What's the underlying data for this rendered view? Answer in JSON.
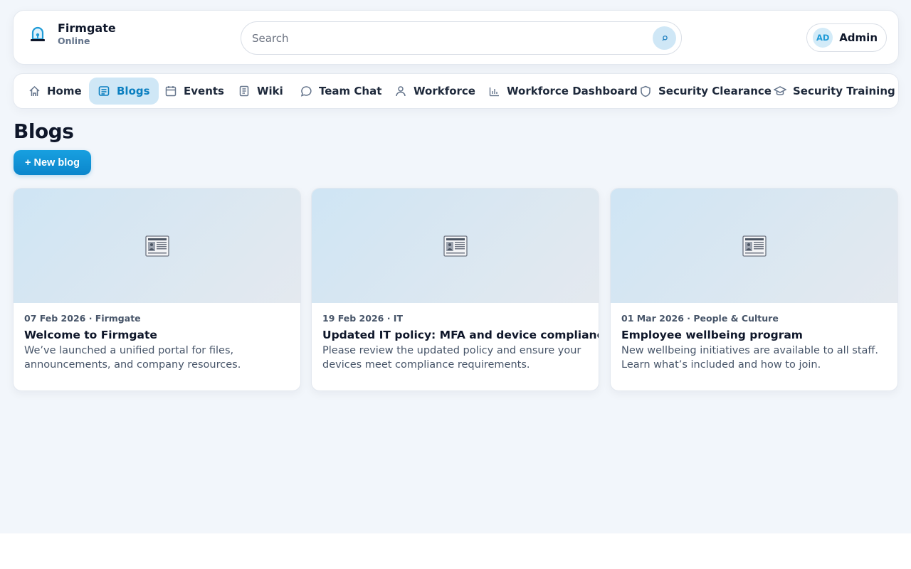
{
  "header": {
    "brand_name": "Firmgate",
    "brand_status": "Online",
    "search_placeholder": "Search",
    "user_initials": "AD",
    "user_name": "Admin"
  },
  "nav": {
    "items": [
      {
        "label": "Home",
        "icon": "home-icon"
      },
      {
        "label": "Blogs",
        "icon": "blog-icon",
        "active": true
      },
      {
        "label": "Events",
        "icon": "calendar-icon"
      },
      {
        "label": "Wiki",
        "icon": "book-icon"
      },
      {
        "label": "Team Chat",
        "icon": "chat-icon"
      },
      {
        "label": "Workforce",
        "icon": "user-icon"
      },
      {
        "label": "Workforce Dashboard",
        "icon": "bar-chart-icon"
      },
      {
        "label": "Security Clearance",
        "icon": "shield-icon"
      },
      {
        "label": "Security Training",
        "icon": "graduation-cap-icon"
      }
    ]
  },
  "main": {
    "title": "Blogs",
    "new_button_label": "+ New blog",
    "posts": [
      {
        "meta": "07 Feb 2026 · Firmgate",
        "title": "Welcome to Firmgate",
        "excerpt": "We’ve launched a unified portal for files, announcements, and company resources.",
        "image_icon": "newspaper-icon"
      },
      {
        "meta": "19 Feb 2026 · IT",
        "title": "Updated IT policy: MFA and device compliance",
        "excerpt": "Please review the updated policy and ensure your devices meet compliance requirements.",
        "image_icon": "newspaper-icon"
      },
      {
        "meta": "01 Mar 2026 · People & Culture",
        "title": "Employee wellbeing program",
        "excerpt": "New wellbeing initiatives are available to all staff. Learn what’s included and how to join.",
        "image_icon": "newspaper-icon"
      }
    ]
  },
  "colors": {
    "accent": "#0b86cc",
    "accent_soft": "#cfe7f6",
    "page_bg": "#f2f6fb"
  }
}
